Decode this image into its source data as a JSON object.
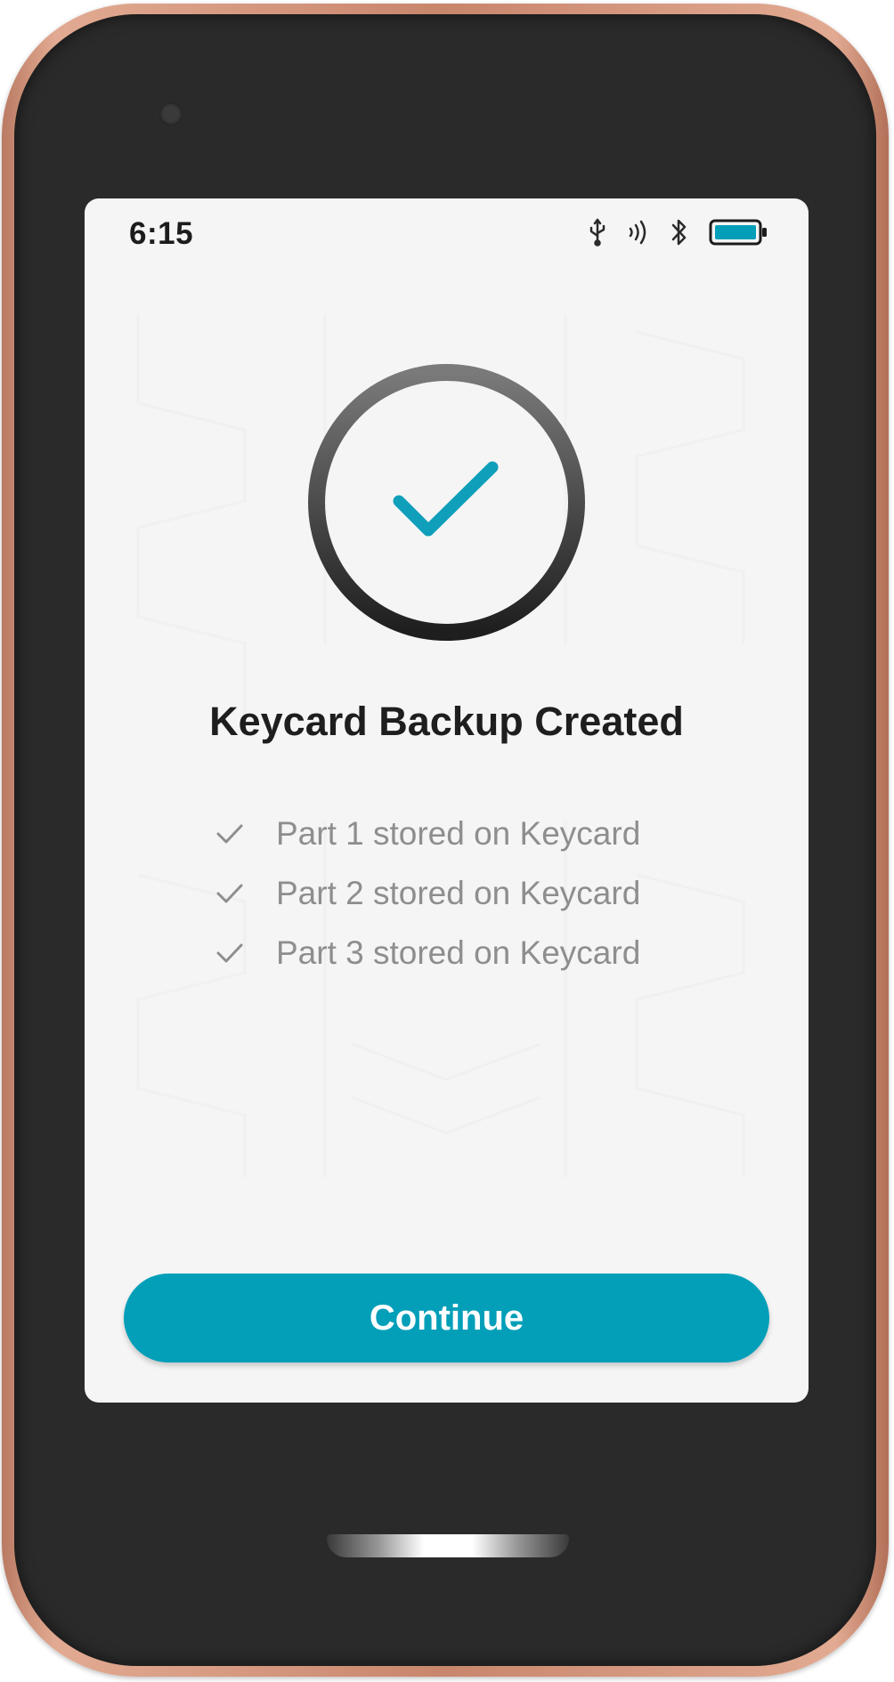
{
  "status_bar": {
    "time": "6:15",
    "icons": [
      "usb-icon",
      "nfc-icon",
      "bluetooth-icon",
      "battery-icon"
    ],
    "battery_level": 1.0
  },
  "main": {
    "status_icon": "check-circle-icon",
    "title": "Keycard Backup Created",
    "parts": [
      {
        "label": "Part 1 stored on Keycard",
        "icon": "check-icon"
      },
      {
        "label": "Part 2 stored on Keycard",
        "icon": "check-icon"
      },
      {
        "label": "Part 3 stored on Keycard",
        "icon": "check-icon"
      }
    ]
  },
  "footer": {
    "continue_label": "Continue"
  },
  "colors": {
    "accent": "#039fb9",
    "title": "#1e1e1e",
    "muted": "#8e8e8e",
    "screen_bg": "#f5f5f5",
    "frame": "#c8866c"
  }
}
